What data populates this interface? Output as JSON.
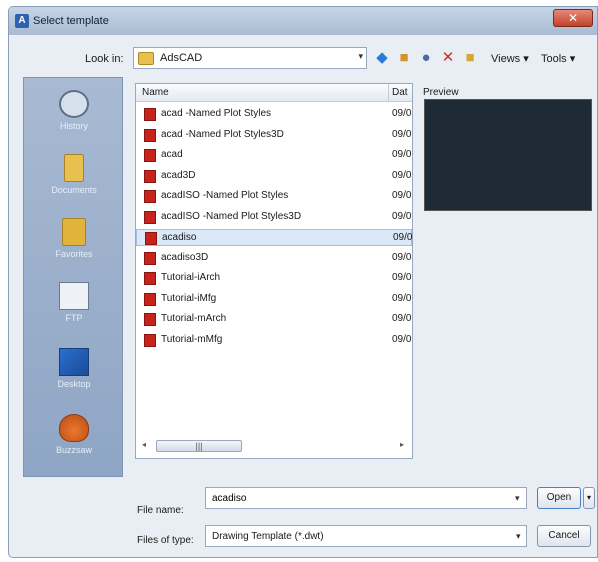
{
  "window": {
    "title": "Select template",
    "app_icon": "A",
    "close_glyph": "✕"
  },
  "toolbar": {
    "look_in_label": "Look in:",
    "look_in_value": "AdsCAD",
    "icons": [
      "back-icon",
      "up-folder-icon",
      "search-icon",
      "delete-icon",
      "create-folder-icon"
    ],
    "views_label": "Views ▾",
    "tools_label": "Tools ▾"
  },
  "places": [
    {
      "label": "History",
      "icon": "history-icon"
    },
    {
      "label": "Documents",
      "icon": "documents-icon"
    },
    {
      "label": "Favorites",
      "icon": "favorites-icon"
    },
    {
      "label": "FTP",
      "icon": "ftp-icon"
    },
    {
      "label": "Desktop",
      "icon": "desktop-icon"
    },
    {
      "label": "Buzzsaw",
      "icon": "buzzsaw-icon"
    }
  ],
  "file_list": {
    "columns": {
      "name": "Name",
      "date": "Dat"
    },
    "rows": [
      {
        "name": "acad -Named Plot Styles",
        "date": "09/0"
      },
      {
        "name": "acad -Named Plot Styles3D",
        "date": "09/0"
      },
      {
        "name": "acad",
        "date": "09/0"
      },
      {
        "name": "acad3D",
        "date": "09/0"
      },
      {
        "name": "acadISO -Named Plot Styles",
        "date": "09/0"
      },
      {
        "name": "acadISO -Named Plot Styles3D",
        "date": "09/0"
      },
      {
        "name": "acadiso",
        "date": "09/0",
        "selected": true
      },
      {
        "name": "acadiso3D",
        "date": "09/0"
      },
      {
        "name": "Tutorial-iArch",
        "date": "09/0"
      },
      {
        "name": "Tutorial-iMfg",
        "date": "09/0"
      },
      {
        "name": "Tutorial-mArch",
        "date": "09/0"
      },
      {
        "name": "Tutorial-mMfg",
        "date": "09/0"
      }
    ],
    "scroll_left": "◂",
    "scroll_thumb": "|||",
    "scroll_right": "▸"
  },
  "preview": {
    "label": "Preview",
    "color": "#1e2a35"
  },
  "footer": {
    "file_name_label": "File name:",
    "file_name_value": "acadiso",
    "files_of_type_label": "Files of type:",
    "files_of_type_value": "Drawing Template (*.dwt)",
    "open_button": "Open",
    "open_dropdown": "▾",
    "cancel_button": "Cancel",
    "dropdown_arrow": "▾"
  }
}
